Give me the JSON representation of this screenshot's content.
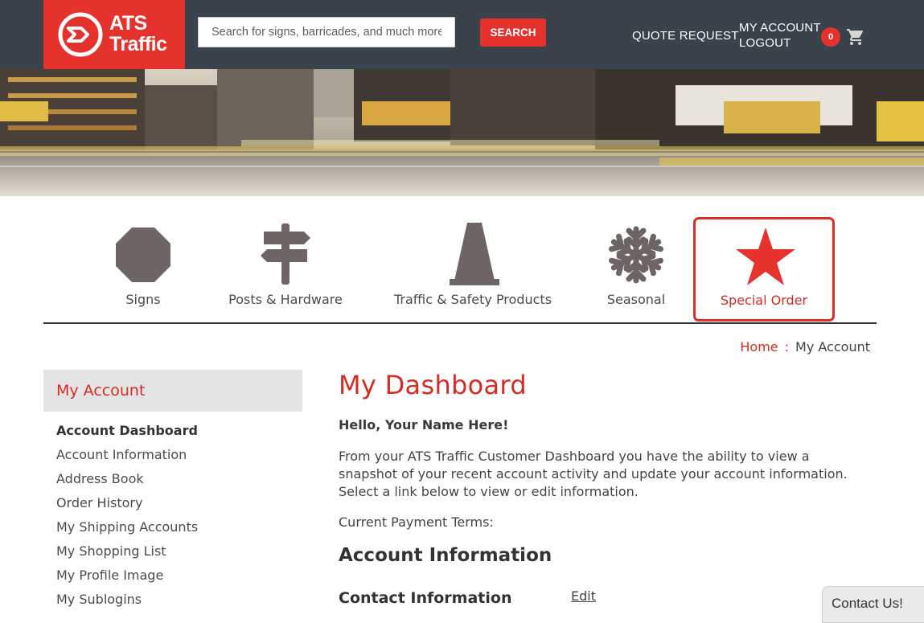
{
  "header": {
    "logo_line1": "ATS",
    "logo_line2": "Traffic",
    "search_placeholder": "Search for signs, barricades, and much more",
    "search_button": "SEARCH",
    "quote_request": "QUOTE REQUEST",
    "my_account": "MY ACCOUNT",
    "logout": "LOGOUT",
    "cart_count": "0",
    "brand_red": "#e5322d",
    "bar_color": "#3a434b"
  },
  "categories": [
    {
      "label": "Signs",
      "icon": "octagon-sign-icon"
    },
    {
      "label": "Posts & Hardware",
      "icon": "signpost-icon"
    },
    {
      "label": "Traffic & Safety Products",
      "icon": "traffic-cone-icon"
    },
    {
      "label": "Seasonal",
      "icon": "snowflake-icon"
    },
    {
      "label": "Special Order",
      "icon": "star-icon",
      "active": true
    }
  ],
  "breadcrumb": {
    "home": "Home",
    "separator": ":",
    "current": "My Account"
  },
  "sidebar": {
    "title": "My Account",
    "items": [
      {
        "label": "Account Dashboard",
        "current": true
      },
      {
        "label": "Account Information"
      },
      {
        "label": "Address Book"
      },
      {
        "label": "Order History"
      },
      {
        "label": "My Shipping Accounts"
      },
      {
        "label": "My Shopping List"
      },
      {
        "label": "My Profile Image"
      },
      {
        "label": "My Sublogins"
      }
    ]
  },
  "main": {
    "title": "My Dashboard",
    "greeting": "Hello, Your Name Here!",
    "intro": "From your ATS Traffic Customer Dashboard you have the ability to view a snapshot of your recent account activity and update your account information. Select a link below to view or edit information.",
    "payment_terms": "Current Payment Terms:",
    "account_info_heading": "Account Information",
    "contact_info_heading": "Contact Information",
    "edit_link": "Edit"
  },
  "contact_widget": {
    "label": "Contact Us!"
  }
}
